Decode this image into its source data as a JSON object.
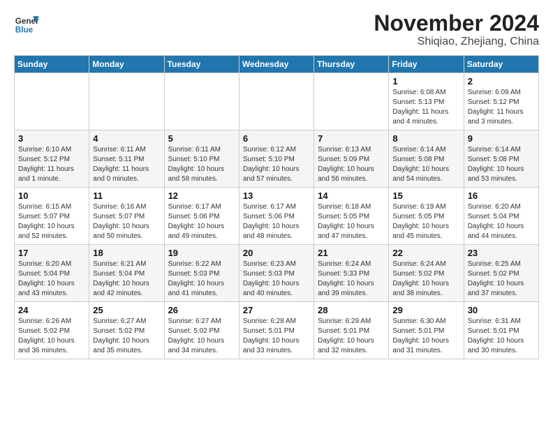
{
  "header": {
    "logo_line1": "General",
    "logo_line2": "Blue",
    "month": "November 2024",
    "location": "Shiqiao, Zhejiang, China"
  },
  "weekdays": [
    "Sunday",
    "Monday",
    "Tuesday",
    "Wednesday",
    "Thursday",
    "Friday",
    "Saturday"
  ],
  "weeks": [
    [
      {
        "day": "",
        "info": ""
      },
      {
        "day": "",
        "info": ""
      },
      {
        "day": "",
        "info": ""
      },
      {
        "day": "",
        "info": ""
      },
      {
        "day": "",
        "info": ""
      },
      {
        "day": "1",
        "info": "Sunrise: 6:08 AM\nSunset: 5:13 PM\nDaylight: 11 hours and 4 minutes."
      },
      {
        "day": "2",
        "info": "Sunrise: 6:09 AM\nSunset: 5:12 PM\nDaylight: 11 hours and 3 minutes."
      }
    ],
    [
      {
        "day": "3",
        "info": "Sunrise: 6:10 AM\nSunset: 5:12 PM\nDaylight: 11 hours and 1 minute."
      },
      {
        "day": "4",
        "info": "Sunrise: 6:11 AM\nSunset: 5:11 PM\nDaylight: 11 hours and 0 minutes."
      },
      {
        "day": "5",
        "info": "Sunrise: 6:11 AM\nSunset: 5:10 PM\nDaylight: 10 hours and 58 minutes."
      },
      {
        "day": "6",
        "info": "Sunrise: 6:12 AM\nSunset: 5:10 PM\nDaylight: 10 hours and 57 minutes."
      },
      {
        "day": "7",
        "info": "Sunrise: 6:13 AM\nSunset: 5:09 PM\nDaylight: 10 hours and 56 minutes."
      },
      {
        "day": "8",
        "info": "Sunrise: 6:14 AM\nSunset: 5:08 PM\nDaylight: 10 hours and 54 minutes."
      },
      {
        "day": "9",
        "info": "Sunrise: 6:14 AM\nSunset: 5:08 PM\nDaylight: 10 hours and 53 minutes."
      }
    ],
    [
      {
        "day": "10",
        "info": "Sunrise: 6:15 AM\nSunset: 5:07 PM\nDaylight: 10 hours and 52 minutes."
      },
      {
        "day": "11",
        "info": "Sunrise: 6:16 AM\nSunset: 5:07 PM\nDaylight: 10 hours and 50 minutes."
      },
      {
        "day": "12",
        "info": "Sunrise: 6:17 AM\nSunset: 5:06 PM\nDaylight: 10 hours and 49 minutes."
      },
      {
        "day": "13",
        "info": "Sunrise: 6:17 AM\nSunset: 5:06 PM\nDaylight: 10 hours and 48 minutes."
      },
      {
        "day": "14",
        "info": "Sunrise: 6:18 AM\nSunset: 5:05 PM\nDaylight: 10 hours and 47 minutes."
      },
      {
        "day": "15",
        "info": "Sunrise: 6:19 AM\nSunset: 5:05 PM\nDaylight: 10 hours and 45 minutes."
      },
      {
        "day": "16",
        "info": "Sunrise: 6:20 AM\nSunset: 5:04 PM\nDaylight: 10 hours and 44 minutes."
      }
    ],
    [
      {
        "day": "17",
        "info": "Sunrise: 6:20 AM\nSunset: 5:04 PM\nDaylight: 10 hours and 43 minutes."
      },
      {
        "day": "18",
        "info": "Sunrise: 6:21 AM\nSunset: 5:04 PM\nDaylight: 10 hours and 42 minutes."
      },
      {
        "day": "19",
        "info": "Sunrise: 6:22 AM\nSunset: 5:03 PM\nDaylight: 10 hours and 41 minutes."
      },
      {
        "day": "20",
        "info": "Sunrise: 6:23 AM\nSunset: 5:03 PM\nDaylight: 10 hours and 40 minutes."
      },
      {
        "day": "21",
        "info": "Sunrise: 6:24 AM\nSunset: 5:33 PM\nDaylight: 10 hours and 39 minutes."
      },
      {
        "day": "22",
        "info": "Sunrise: 6:24 AM\nSunset: 5:02 PM\nDaylight: 10 hours and 38 minutes."
      },
      {
        "day": "23",
        "info": "Sunrise: 6:25 AM\nSunset: 5:02 PM\nDaylight: 10 hours and 37 minutes."
      }
    ],
    [
      {
        "day": "24",
        "info": "Sunrise: 6:26 AM\nSunset: 5:02 PM\nDaylight: 10 hours and 36 minutes."
      },
      {
        "day": "25",
        "info": "Sunrise: 6:27 AM\nSunset: 5:02 PM\nDaylight: 10 hours and 35 minutes."
      },
      {
        "day": "26",
        "info": "Sunrise: 6:27 AM\nSunset: 5:02 PM\nDaylight: 10 hours and 34 minutes."
      },
      {
        "day": "27",
        "info": "Sunrise: 6:28 AM\nSunset: 5:01 PM\nDaylight: 10 hours and 33 minutes."
      },
      {
        "day": "28",
        "info": "Sunrise: 6:29 AM\nSunset: 5:01 PM\nDaylight: 10 hours and 32 minutes."
      },
      {
        "day": "29",
        "info": "Sunrise: 6:30 AM\nSunset: 5:01 PM\nDaylight: 10 hours and 31 minutes."
      },
      {
        "day": "30",
        "info": "Sunrise: 6:31 AM\nSunset: 5:01 PM\nDaylight: 10 hours and 30 minutes."
      }
    ]
  ]
}
